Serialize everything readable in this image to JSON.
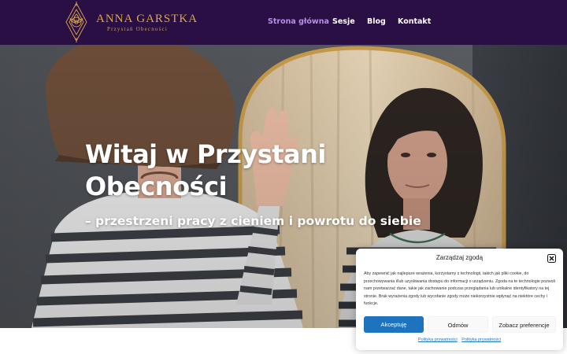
{
  "brand": {
    "title": "ANNA GARSTKA",
    "subtitle": "Przystań Obecności"
  },
  "nav": {
    "items": [
      {
        "label": "Strona główna",
        "active": true
      },
      {
        "label": "Sesje",
        "active": false
      },
      {
        "label": "Blog",
        "active": false
      },
      {
        "label": "Kontakt",
        "active": false
      }
    ]
  },
  "hero": {
    "title": "Witaj w Przystani Obecności",
    "subtitle": "– przestrzeni pracy z cieniem i powrotu do siebie"
  },
  "consent": {
    "title": "Zarządzaj zgodą",
    "text": "Aby zapewnić jak najlepsze wrażenia, korzystamy z technologii, takich jak pliki cookie, do przechowywania i/lub uzyskiwania dostępu do informacji o urządzeniu. Zgoda na te technologie pozwoli nam przetwarzać dane, takie jak zachowanie podczas przeglądania lub unikalne identyfikatory na tej stronie. Brak wyrażenia zgody lub wycofanie zgody może niekorzystnie wpłynąć na niektóre cechy i funkcje.",
    "accept_label": "Akceptuję",
    "deny_label": "Odmów",
    "prefs_label": "Zobacz preferencje",
    "links": [
      "Polityka prywatności",
      "Polityka prywatności"
    ]
  },
  "colors": {
    "header_bg": "#2a0f45",
    "brand_gold": "#d9a64b",
    "nav_active": "#b98ee8",
    "accept_bg": "#1e73be"
  },
  "icons": {
    "logo": "lotus-mandala-icon",
    "close": "close-icon"
  }
}
